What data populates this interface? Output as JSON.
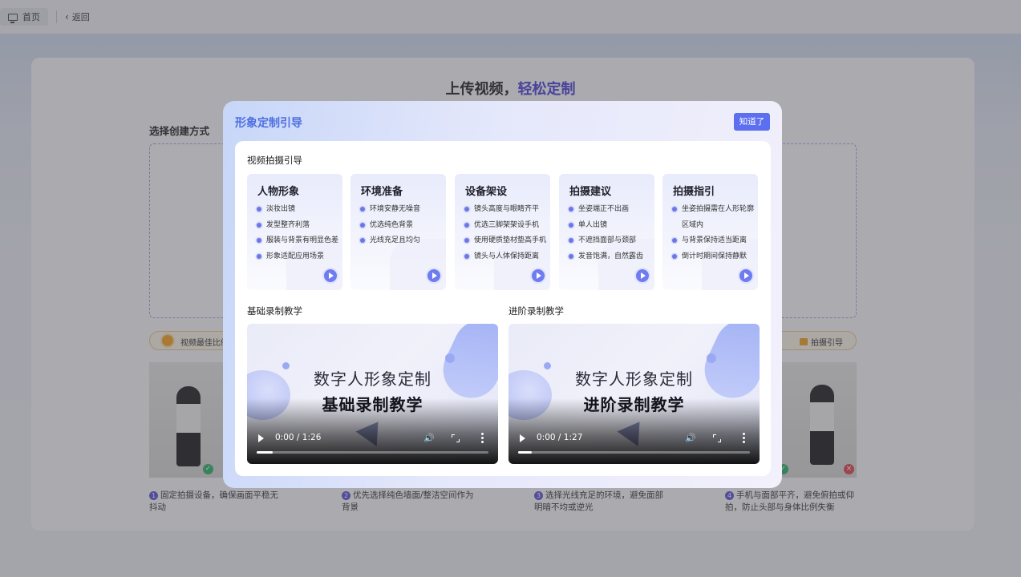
{
  "topbar": {
    "home_label": "首页",
    "back_label": "返回"
  },
  "page": {
    "title_plain": "上传视频，",
    "title_highlight": "轻松定制",
    "choose_label": "选择创建方式",
    "tip_text": "视频最佳比例",
    "guide_link": "拍摄引导",
    "steps": [
      {
        "num": "1",
        "text": "固定拍摄设备，确保画面平稳无抖动"
      },
      {
        "num": "2",
        "text": "优先选择纯色墙面/整洁空间作为背景"
      },
      {
        "num": "3",
        "text": "选择光线充足的环境，避免面部明暗不均或逆光"
      },
      {
        "num": "4",
        "text": "手机与面部平齐，避免俯拍或仰拍，防止头部与身体比例失衡"
      }
    ]
  },
  "modal": {
    "title": "形象定制引导",
    "ok_label": "知道了",
    "shooting_section": "视频拍摄引导",
    "cards": [
      {
        "title": "人物形象",
        "items": [
          "淡妆出镜",
          "发型整齐利落",
          "服装与背景有明显色差",
          "形象适配应用场景"
        ]
      },
      {
        "title": "环境准备",
        "items": [
          "环境安静无噪音",
          "优选纯色背景",
          "光线充足且均匀"
        ]
      },
      {
        "title": "设备架设",
        "items": [
          "镜头高度与眼睛齐平",
          "优选三脚架架设手机",
          "使用硬质垫材垫高手机",
          "镜头与人体保持距离"
        ]
      },
      {
        "title": "拍摄建议",
        "items": [
          "坐姿端正不出画",
          "单人出镜",
          "不遮挡面部与颈部",
          "发音饱满，自然露齿"
        ]
      },
      {
        "title": "拍摄指引",
        "items": [
          "坐姿拍摄需在人形轮廓",
          "区域内",
          "与背景保持适当距离",
          "倒计时期间保持静默"
        ]
      }
    ],
    "videos": [
      {
        "section": "基础录制教学",
        "line1": "数字人形象定制",
        "line2": "基础录制教学",
        "time": "0:00 / 1:26",
        "progress": 0.07
      },
      {
        "section": "进阶录制教学",
        "line1": "数字人形象定制",
        "line2": "进阶录制教学",
        "time": "0:00 / 1:27",
        "progress": 0.06
      }
    ]
  },
  "colors": {
    "accent": "#5b6ff0",
    "title_blue": "#4d6fe0",
    "highlight_purple": "#4b3fd8"
  }
}
